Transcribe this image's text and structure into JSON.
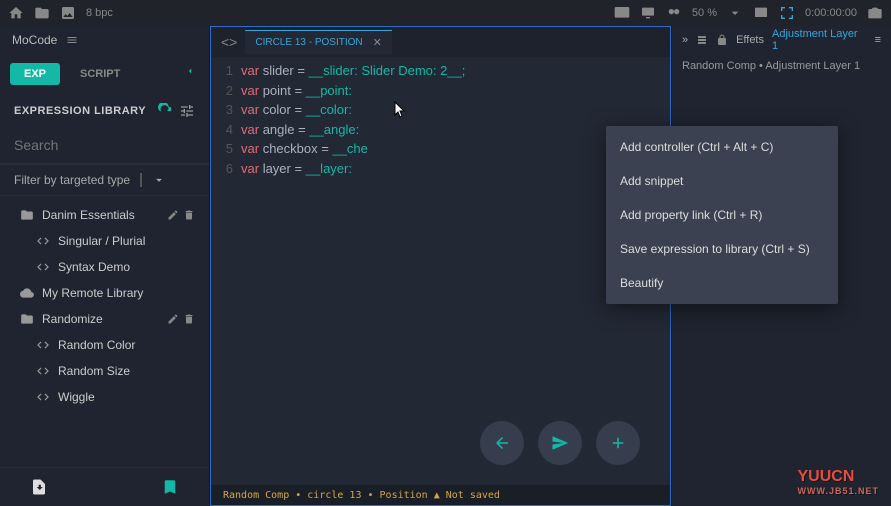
{
  "top": {
    "bpc_label": "8 bpc",
    "zoom": "50 %",
    "time": "0:00:00:00"
  },
  "panel_name": "MoCode",
  "tabs": {
    "exp": "EXP",
    "script": "SCRIPT"
  },
  "section": {
    "title": "EXPRESSION LIBRARY"
  },
  "search": {
    "placeholder": "Search"
  },
  "filter": {
    "label": "Filter by targeted type"
  },
  "tree": {
    "danim": "Danim Essentials",
    "singular": "Singular / Plurial",
    "syntax": "Syntax Demo",
    "remote": "My Remote Library",
    "randomize": "Randomize",
    "rcolor": "Random Color",
    "rsize": "Random Size",
    "wiggle": "Wiggle"
  },
  "editor": {
    "tab_label": "CIRCLE 13 - POSITION",
    "lines": [
      {
        "n": 1,
        "kw": "var",
        "id": "slider",
        "rest": "__slider: Slider Demo: 2__;"
      },
      {
        "n": 2,
        "kw": "var",
        "id": "point",
        "rest": "__point:"
      },
      {
        "n": 3,
        "kw": "var",
        "id": "color",
        "rest": "__color:"
      },
      {
        "n": 4,
        "kw": "var",
        "id": "angle",
        "rest": "__angle:"
      },
      {
        "n": 5,
        "kw": "var",
        "id": "checkbox",
        "rest": "__che"
      },
      {
        "n": 6,
        "kw": "var",
        "id": "layer",
        "rest": "__layer:"
      }
    ]
  },
  "context": {
    "add_controller": "Add controller (Ctrl + Alt + C)",
    "add_snippet": "Add snippet",
    "add_link": "Add property link (Ctrl + R)",
    "save_expr": "Save expression to library (Ctrl + S)",
    "beautify": "Beautify"
  },
  "status": "Random Comp • circle 13 • Position ▲ Not saved",
  "right": {
    "effects": "Effets",
    "layer_link": "Adjustment Layer 1",
    "breadcrumb": "Random Comp • Adjustment Layer 1"
  },
  "watermark": {
    "main": "YUUCN",
    "sub": "WWW.JB51.NET"
  }
}
